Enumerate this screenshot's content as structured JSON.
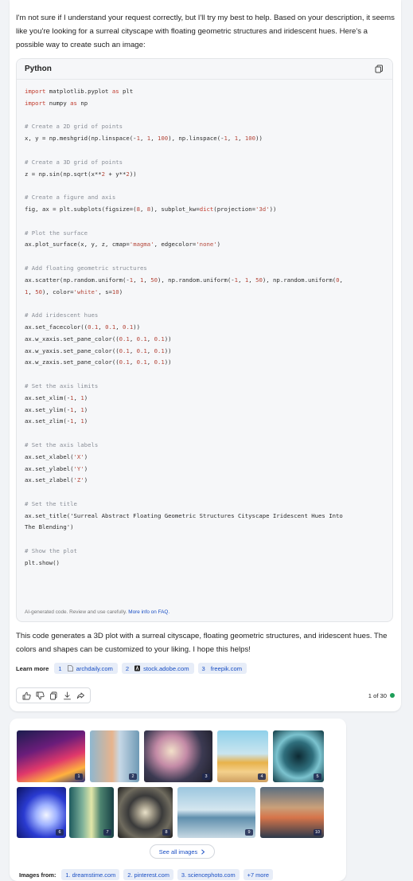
{
  "intro": "I'm not sure if I understand your request correctly, but I'll try my best to help. Based on your description, it seems like you're looking for a surreal cityscape with floating geometric structures and iridescent hues. Here's a possible way to create such an image:",
  "code": {
    "language": "Python",
    "lines": [
      "import matplotlib.pyplot as plt",
      "import numpy as np",
      "",
      "# Create a 2D grid of points",
      "x, y = np.meshgrid(np.linspace(-1, 1, 100), np.linspace(-1, 1, 100))",
      "",
      "# Create a 3D grid of points",
      "z = np.sin(np.sqrt(x**2 + y**2))",
      "",
      "# Create a figure and axis",
      "fig, ax = plt.subplots(figsize=(8, 8), subplot_kw=dict(projection='3d'))",
      "",
      "# Plot the surface",
      "ax.plot_surface(x, y, z, cmap='magma', edgecolor='none')",
      "",
      "# Add floating geometric structures",
      "ax.scatter(np.random.uniform(-1, 1, 50), np.random.uniform(-1, 1, 50), np.random.uniform(0,",
      "1, 50), color='white', s=10)",
      "",
      "# Add iridescent hues",
      "ax.set_facecolor((0.1, 0.1, 0.1))",
      "ax.w_xaxis.set_pane_color((0.1, 0.1, 0.1))",
      "ax.w_yaxis.set_pane_color((0.1, 0.1, 0.1))",
      "ax.w_zaxis.set_pane_color((0.1, 0.1, 0.1))",
      "",
      "# Set the axis limits",
      "ax.set_xlim(-1, 1)",
      "ax.set_ylim(-1, 1)",
      "ax.set_zlim(-1, 1)",
      "",
      "# Set the axis labels",
      "ax.set_xlabel('X')",
      "ax.set_ylabel('Y')",
      "ax.set_zlabel('Z')",
      "",
      "# Set the title",
      "ax.set_title('Surreal Abstract Floating Geometric Structures Cityscape Iridescent Hues Into",
      "The Blending')",
      "",
      "# Show the plot",
      "plt.show()"
    ],
    "footer_text": "AI-generated code. Review and use carefully.",
    "footer_link": "More info on FAQ.",
    "copy_icon": "copy-icon"
  },
  "outro": "This code generates a 3D plot with a surreal cityscape, floating geometric structures, and iridescent hues. The colors and shapes can be customized to your liking. I hope this helps!",
  "learn_more": {
    "label": "Learn more",
    "sources": [
      {
        "num": "1",
        "icon": "page-icon",
        "text": "archdaily.com"
      },
      {
        "num": "2",
        "icon": "adobe-icon",
        "text": "stock.adobe.com"
      },
      {
        "num": "3",
        "icon": "",
        "text": "freepik.com"
      }
    ]
  },
  "actions": {
    "icons": [
      "thumbs-up-icon",
      "thumbs-down-icon",
      "copy-icon",
      "download-icon",
      "share-icon"
    ],
    "count": "1 of 30",
    "status_color": "#1e9e58"
  },
  "images": {
    "badges": [
      "1",
      "2",
      "3",
      "4",
      "5",
      "6",
      "7",
      "8",
      "9",
      "10"
    ],
    "see_all": "See all images",
    "from_label": "Images from:",
    "from_sources": [
      "1. dreamstime.com",
      "2. pinterest.com",
      "3. sciencephoto.com",
      "+7 more"
    ]
  },
  "colors": {
    "accent": "#1a4fc4",
    "chip_bg": "#e7edf8",
    "page_bg": "#f1f3f6"
  }
}
